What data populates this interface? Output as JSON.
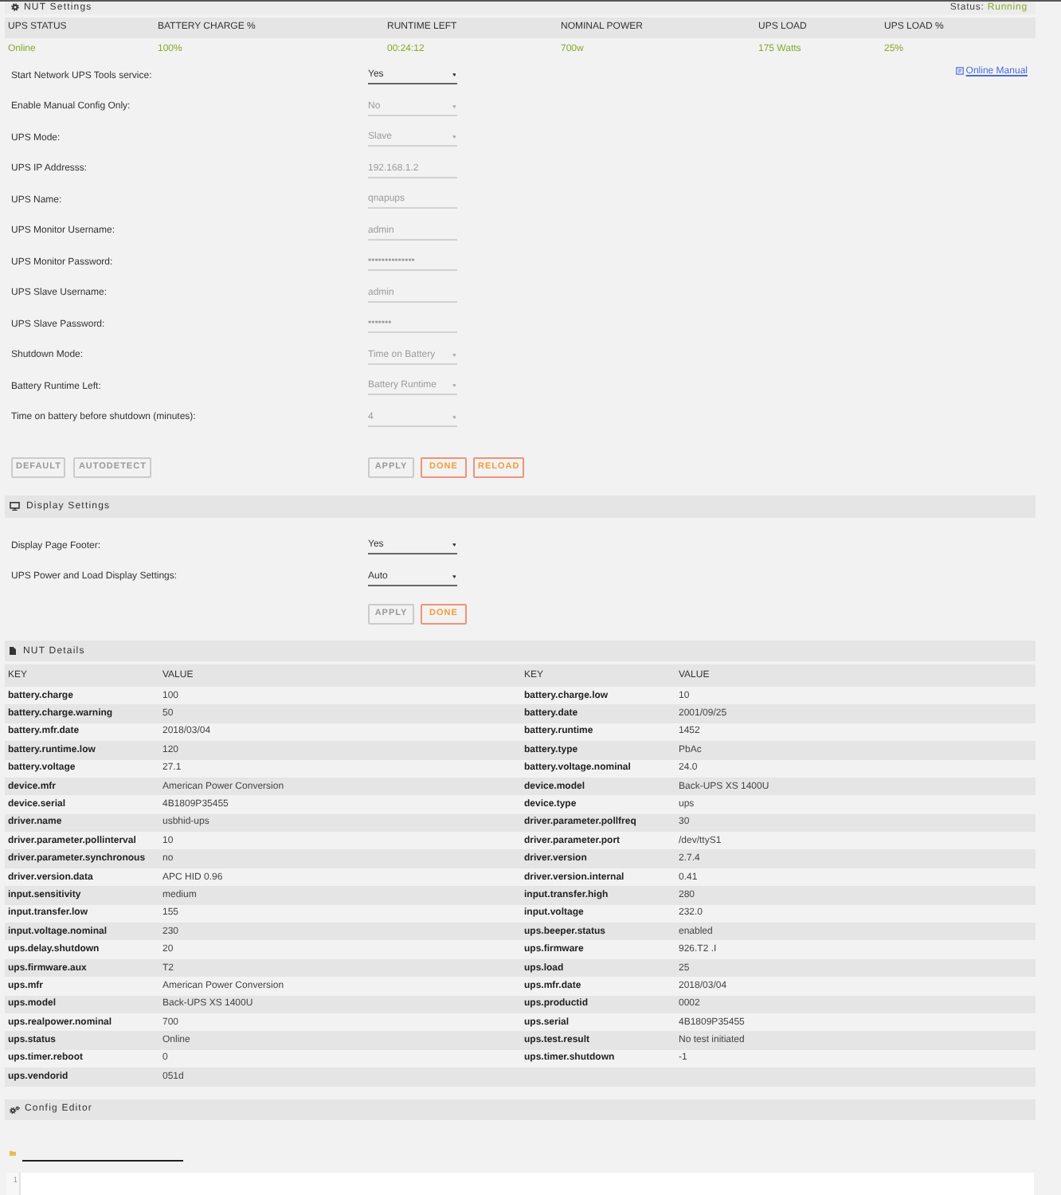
{
  "settings_panel": {
    "title": "NUT Settings",
    "status_label": "Status:",
    "status_value": "Running"
  },
  "ups_summary": {
    "columns": [
      "UPS STATUS",
      "BATTERY CHARGE %",
      "RUNTIME LEFT",
      "NOMINAL POWER",
      "UPS LOAD",
      "UPS LOAD %"
    ],
    "values": [
      "Online",
      "100%",
      "00:24:12",
      "700w",
      "175 Watts",
      "25%"
    ]
  },
  "online_manual": {
    "label": "Online Manual"
  },
  "settings": [
    {
      "label": "Start Network UPS Tools service:",
      "kind": "select",
      "value": "Yes",
      "disabled": false
    },
    {
      "label": "Enable Manual Config Only:",
      "kind": "select",
      "value": "No",
      "disabled": true
    },
    {
      "label": "UPS Mode:",
      "kind": "select",
      "value": "Slave",
      "disabled": true
    },
    {
      "label": "UPS IP Addresss:",
      "kind": "text",
      "value": "192.168.1.2",
      "disabled": true
    },
    {
      "label": "UPS Name:",
      "kind": "text",
      "value": "qnapups",
      "disabled": true
    },
    {
      "label": "UPS Monitor Username:",
      "kind": "text",
      "value": "admin",
      "disabled": true
    },
    {
      "label": "UPS Monitor Password:",
      "kind": "password",
      "value": "••••••••••••••",
      "disabled": true
    },
    {
      "label": "UPS Slave Username:",
      "kind": "text",
      "value": "admin",
      "disabled": true
    },
    {
      "label": "UPS Slave Password:",
      "kind": "password",
      "value": "•••••••",
      "disabled": true
    },
    {
      "label": "Shutdown Mode:",
      "kind": "select",
      "value": "Time on Battery",
      "disabled": true
    },
    {
      "label": "Battery Runtime Left:",
      "kind": "select",
      "value": "Battery Runtime",
      "disabled": true
    },
    {
      "label": "Time on battery before shutdown (minutes):",
      "kind": "select",
      "value": "4",
      "disabled": true
    }
  ],
  "settings_buttons": {
    "left": [
      {
        "label": "DEFAULT",
        "disabled": true
      },
      {
        "label": "AUTODETECT",
        "disabled": true
      }
    ],
    "right": [
      {
        "label": "APPLY",
        "disabled": true
      },
      {
        "label": "DONE",
        "disabled": false
      },
      {
        "label": "RELOAD",
        "disabled": false
      }
    ]
  },
  "display_panel": {
    "title": "Display Settings"
  },
  "display_settings": [
    {
      "label": "Display Page Footer:",
      "kind": "select",
      "value": "Yes",
      "disabled": false
    },
    {
      "label": "UPS Power and Load Display Settings:",
      "kind": "select",
      "value": "Auto",
      "disabled": false
    }
  ],
  "display_buttons": [
    {
      "label": "APPLY",
      "disabled": true
    },
    {
      "label": "DONE",
      "disabled": false
    }
  ],
  "details_panel": {
    "title": "NUT Details",
    "columns": [
      "KEY",
      "VALUE",
      "KEY",
      "VALUE"
    ],
    "rows": [
      [
        "battery.charge",
        "100",
        "battery.charge.low",
        "10"
      ],
      [
        "battery.charge.warning",
        "50",
        "battery.date",
        "2001/09/25"
      ],
      [
        "battery.mfr.date",
        "2018/03/04",
        "battery.runtime",
        "1452"
      ],
      [
        "battery.runtime.low",
        "120",
        "battery.type",
        "PbAc"
      ],
      [
        "battery.voltage",
        "27.1",
        "battery.voltage.nominal",
        "24.0"
      ],
      [
        "device.mfr",
        "American Power Conversion",
        "device.model",
        "Back-UPS XS 1400U"
      ],
      [
        "device.serial",
        "4B1809P35455",
        "device.type",
        "ups"
      ],
      [
        "driver.name",
        "usbhid-ups",
        "driver.parameter.pollfreq",
        "30"
      ],
      [
        "driver.parameter.pollinterval",
        "10",
        "driver.parameter.port",
        "/dev/ttyS1"
      ],
      [
        "driver.parameter.synchronous",
        "no",
        "driver.version",
        "2.7.4"
      ],
      [
        "driver.version.data",
        "APC HID 0.96",
        "driver.version.internal",
        "0.41"
      ],
      [
        "input.sensitivity",
        "medium",
        "input.transfer.high",
        "280"
      ],
      [
        "input.transfer.low",
        "155",
        "input.voltage",
        "232.0"
      ],
      [
        "input.voltage.nominal",
        "230",
        "ups.beeper.status",
        "enabled"
      ],
      [
        "ups.delay.shutdown",
        "20",
        "ups.firmware",
        "926.T2 .I"
      ],
      [
        "ups.firmware.aux",
        "T2",
        "ups.load",
        "25"
      ],
      [
        "ups.mfr",
        "American Power Conversion",
        "ups.mfr.date",
        "2018/03/04"
      ],
      [
        "ups.model",
        "Back-UPS XS 1400U",
        "ups.productid",
        "0002"
      ],
      [
        "ups.realpower.nominal",
        "700",
        "ups.serial",
        "4B1809P35455"
      ],
      [
        "ups.status",
        "Online",
        "ups.test.result",
        "No test initiated"
      ],
      [
        "ups.timer.reboot",
        "0",
        "ups.timer.shutdown",
        "-1"
      ],
      [
        "ups.vendorid",
        "051d"
      ]
    ]
  },
  "config_editor": {
    "title": "Config Editor",
    "line_numbers": [
      "1"
    ]
  }
}
